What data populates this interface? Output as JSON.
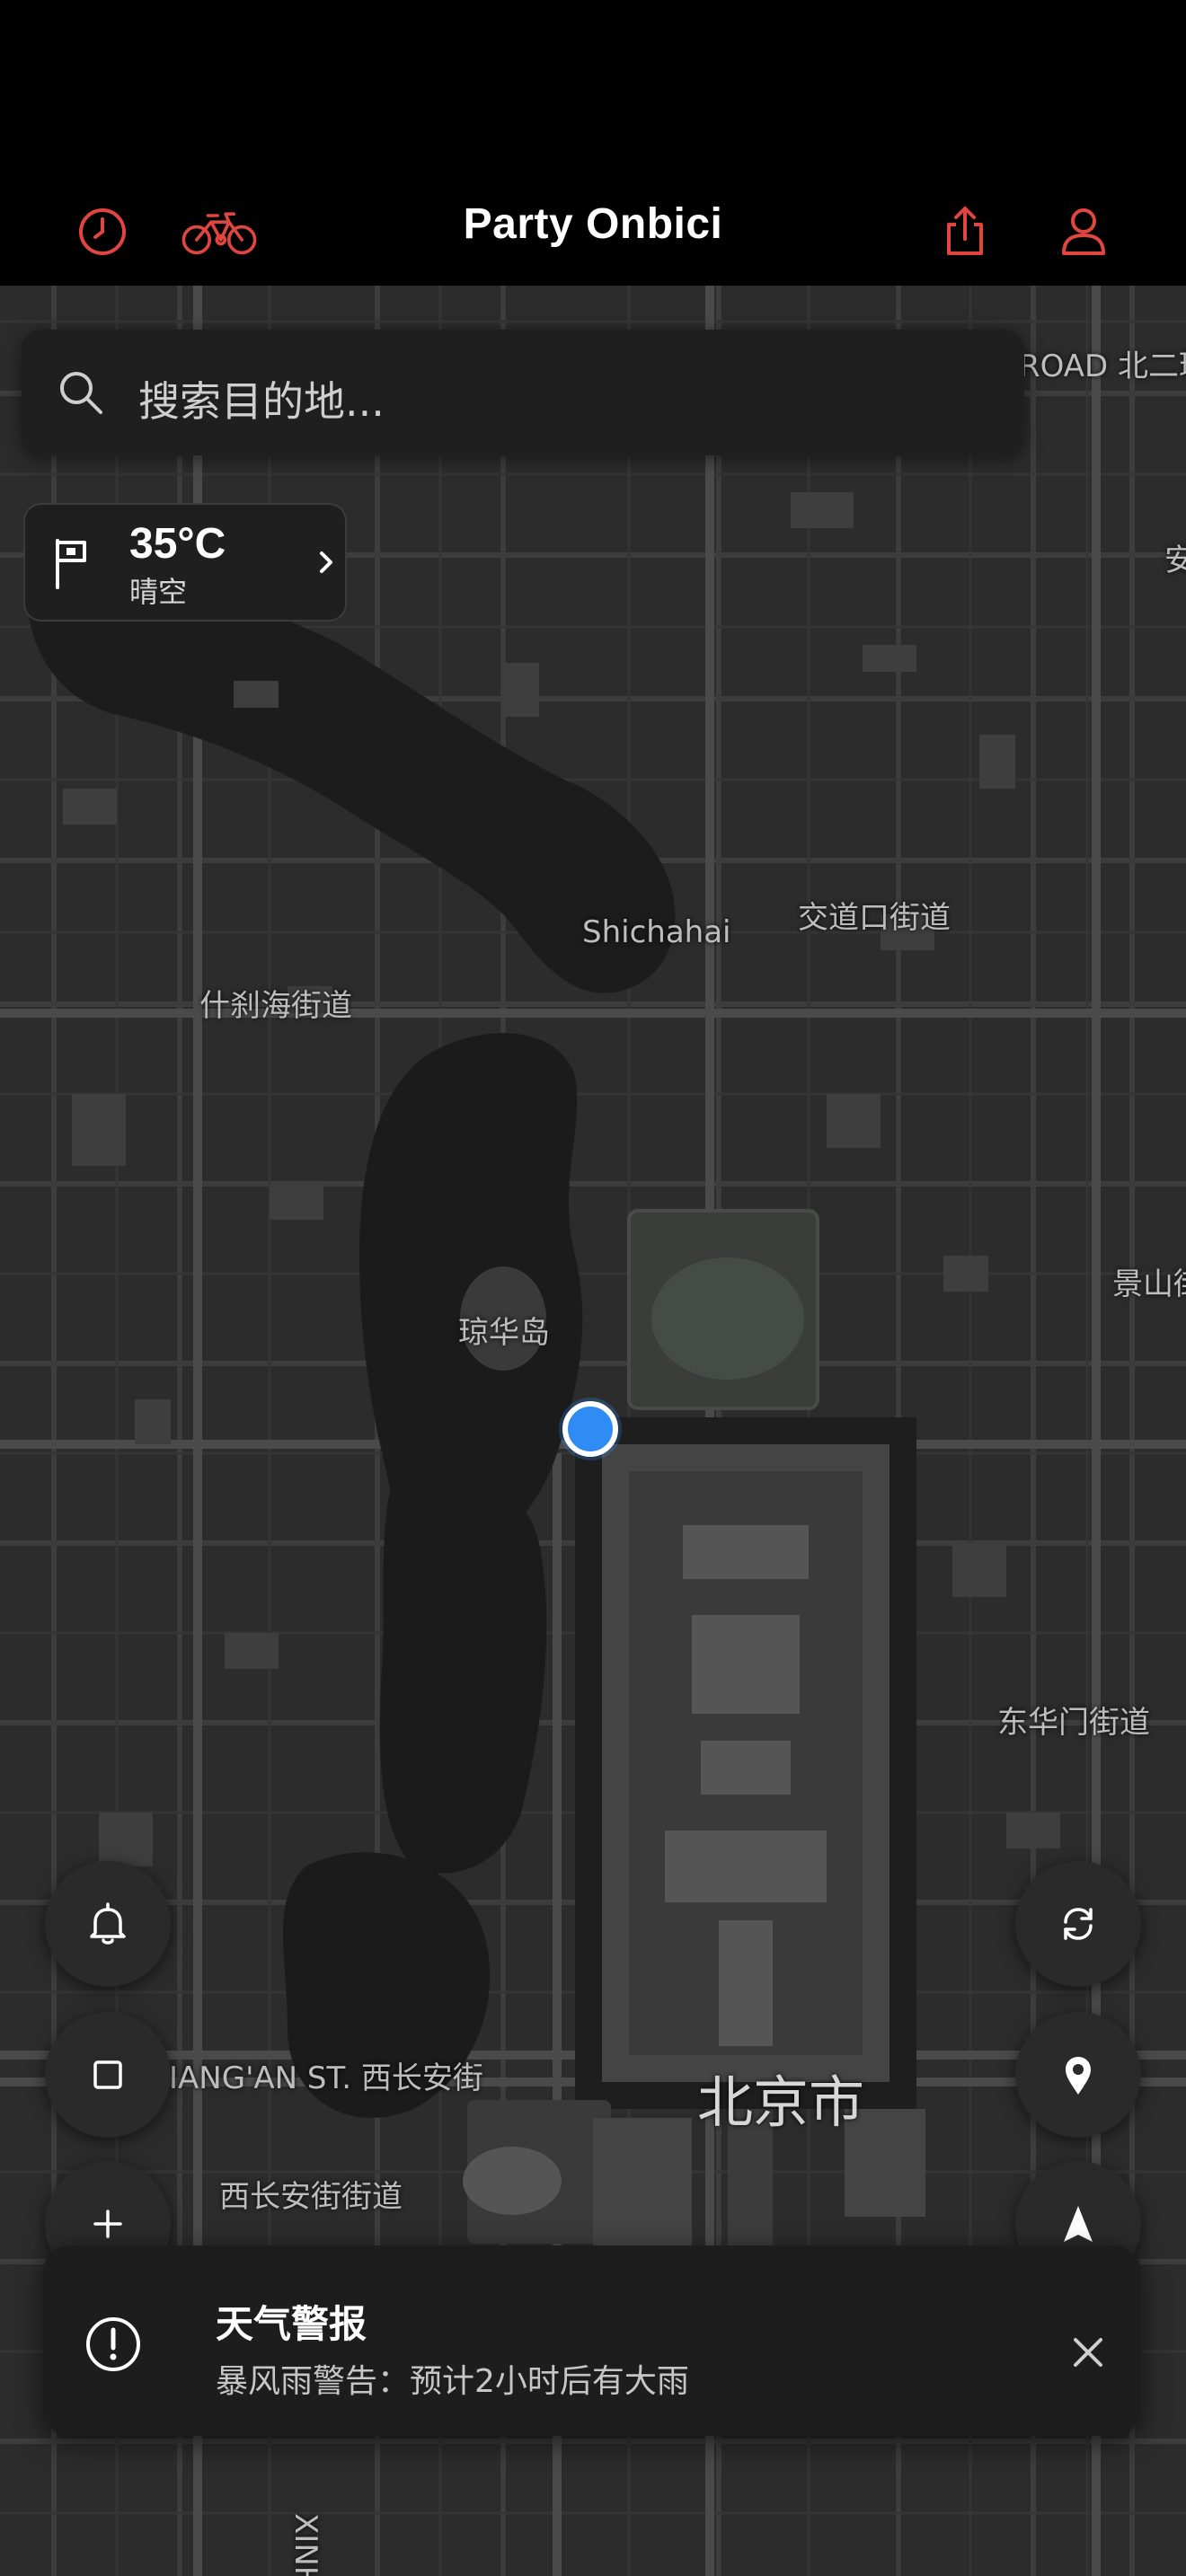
{
  "app": {
    "title": "Party Onbici"
  },
  "header": {
    "left_icons": [
      "clock-icon",
      "bicycle-icon"
    ],
    "right_icons": [
      "share-icon",
      "profile-icon"
    ],
    "accent_color": "#e0463f"
  },
  "search": {
    "placeholder": "搜索目的地..."
  },
  "weather": {
    "temperature": "35°C",
    "condition": "晴空"
  },
  "map": {
    "labels": {
      "shichahai": "Shichahai",
      "jiaodaokou": "交道口街道",
      "shichahai_street": "什刹海街道",
      "qionghuadao": "琼华岛",
      "jingshan": "景山街",
      "donghuamen": "东华门街道",
      "changan": "IANG'AN ST. 西长安街",
      "beijing": "北京市",
      "xichangan_street": "西长安街街道",
      "road_top": "ROAD 北二环",
      "xinhua": "XINHUA S",
      "an": "安"
    }
  },
  "controls": {
    "left": [
      "bell-icon",
      "square-icon",
      "plus-icon"
    ],
    "right": [
      "refresh-icon",
      "map-pin-icon",
      "navigation-arrow-icon"
    ]
  },
  "alert": {
    "title": "天气警报",
    "message": "暴风雨警告：预计2小时后有大雨"
  },
  "colors": {
    "location_dot": "#2f8cf4",
    "map_bg": "#2c2c2c",
    "water": "#1b1b1b"
  }
}
